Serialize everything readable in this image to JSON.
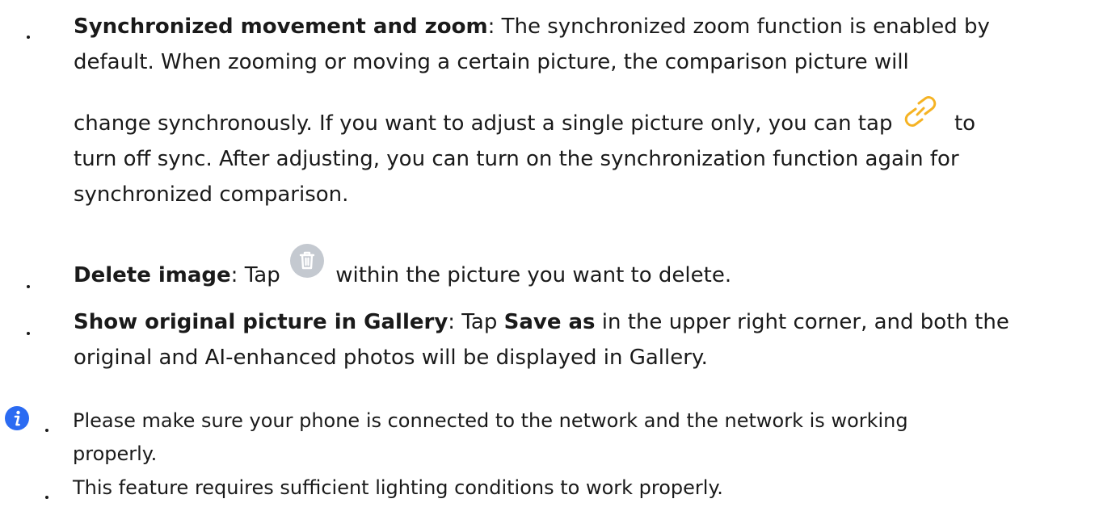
{
  "colors": {
    "text": "#1a1a1a",
    "link_icon": "#f5b324",
    "delete_icon_bg": "#c4c9d0",
    "info_icon": "#2b6bf2"
  },
  "icons": {
    "link": "link-icon",
    "delete": "trash-icon",
    "info": "info-icon"
  },
  "items": [
    {
      "title": "Synchronized movement and zoom",
      "line1": ": The synchronized zoom function is enabled by",
      "line2": "default. When zooming or moving a certain picture, the comparison picture will",
      "line3_before": "change synchronously. If you want to adjust a single picture only, you can tap",
      "line3_after": "to",
      "line4": "turn off sync. After adjusting, you can turn on the synchronization function again for",
      "line5": "synchronized comparison."
    },
    {
      "title": "Delete image",
      "before": ": Tap",
      "after": "within the picture you want to delete."
    },
    {
      "title": "Show original picture in Gallery",
      "before": ": Tap ",
      "bold_mid": "Save as",
      "after": " in the upper right corner, and both the",
      "line2": "original and AI-enhanced photos will be displayed in Gallery."
    }
  ],
  "notes": [
    {
      "line1": "Please make sure your phone is connected to the network and the network is working",
      "line2": "properly."
    },
    {
      "line1": "This feature requires sufficient lighting conditions to work properly."
    }
  ]
}
